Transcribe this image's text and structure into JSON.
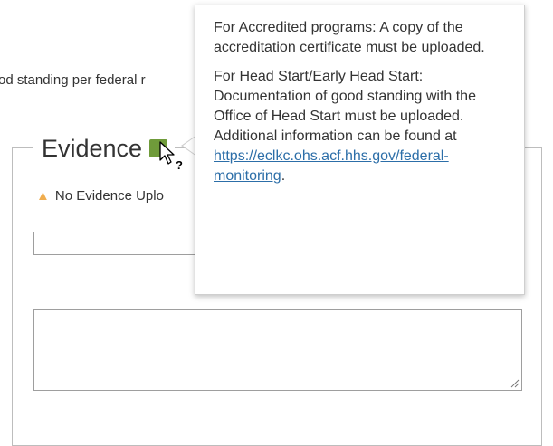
{
  "background_text": "od standing per federal r",
  "evidence": {
    "legend": "Evidence",
    "warning_text": "No Evidence Uplo"
  },
  "popover": {
    "paragraph1": "For Accredited programs: A copy of the accreditation certificate must be uploaded.",
    "paragraph2_text": "For Head Start/Early Head Start: Documentation of good standing with the Office of Head Start must be uploaded. Additional information can be found at",
    "link_text": "https://eclkc.ohs.acf.hhs.gov/federal-monitoring",
    "link_suffix": "."
  },
  "colors": {
    "help_button": "#6f9b3a",
    "warning_icon": "#f0ad4e",
    "link": "#2c6ea8"
  },
  "icons": {
    "help": "help-icon",
    "warning": "warning-icon",
    "cursor": "help-cursor-icon"
  }
}
